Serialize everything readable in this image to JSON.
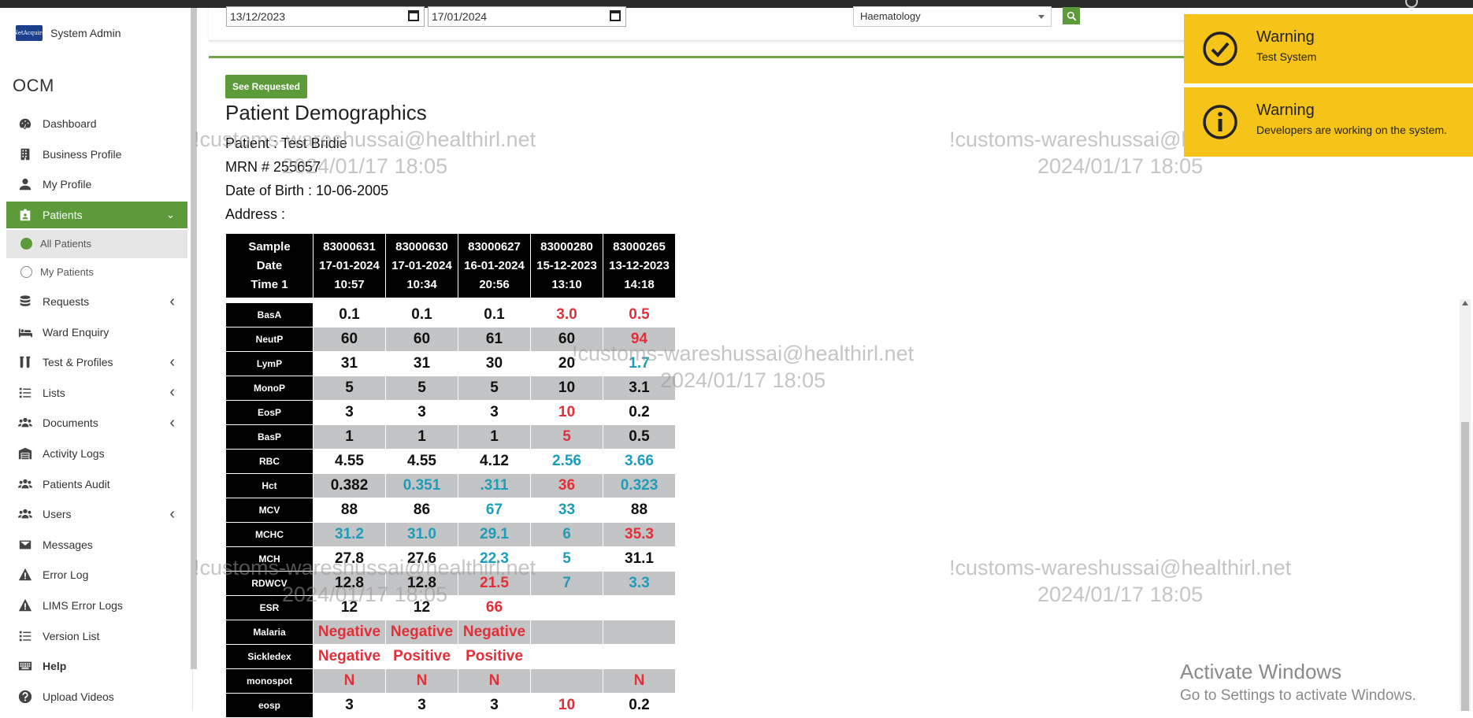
{
  "sidebar": {
    "logo_text": "NetAcquire",
    "user_name": "System Admin",
    "brand": "OCM",
    "items": [
      {
        "label": "Dashboard",
        "icon": "dashboard-icon"
      },
      {
        "label": "Business Profile",
        "icon": "building-icon"
      },
      {
        "label": "My Profile",
        "icon": "user-icon"
      },
      {
        "label": "Patients",
        "icon": "patients-icon",
        "chevron": "down"
      },
      {
        "label": "All Patients",
        "sub": true
      },
      {
        "label": "My Patients",
        "sub": true
      },
      {
        "label": "Requests",
        "icon": "database-icon",
        "chevron": "left"
      },
      {
        "label": "Ward Enquiry",
        "icon": "bed-icon"
      },
      {
        "label": "Test & Profiles",
        "icon": "flask-icon",
        "chevron": "left"
      },
      {
        "label": "Lists",
        "icon": "list-icon",
        "chevron": "left"
      },
      {
        "label": "Documents",
        "icon": "users-icon",
        "chevron": "left"
      },
      {
        "label": "Activity Logs",
        "icon": "warehouse-icon"
      },
      {
        "label": "Patients Audit",
        "icon": "users-icon"
      },
      {
        "label": "Users",
        "icon": "users-icon",
        "chevron": "left"
      },
      {
        "label": "Messages",
        "icon": "envelope-icon"
      },
      {
        "label": "Error Log",
        "icon": "warning-icon"
      },
      {
        "label": "LIMS Error Logs",
        "icon": "warning-icon"
      },
      {
        "label": "Version List",
        "icon": "list-icon"
      },
      {
        "label": "Help",
        "icon": "keyboard-icon"
      },
      {
        "label": "Upload Videos",
        "icon": "question-icon"
      }
    ]
  },
  "filters": {
    "date_from": "13/12/2023",
    "date_to": "17/01/2024",
    "department": "Haematology"
  },
  "actions": {
    "see_requested": "See Requested"
  },
  "patient": {
    "section_title": "Patient Demographics",
    "name_line": "Patient : Test Bridie",
    "mrn_line": "MRN # 255657",
    "dob_line": "Date of Birth : 10-06-2005",
    "address_line": "Address :"
  },
  "results_table": {
    "header_first": [
      "Sample",
      "Date",
      "Time 1"
    ],
    "columns": [
      [
        "83000631",
        "17-01-2024",
        "10:57"
      ],
      [
        "83000630",
        "17-01-2024",
        "10:34"
      ],
      [
        "83000627",
        "16-01-2024",
        "20:56"
      ],
      [
        "83000280",
        "15-12-2023",
        "13:10"
      ],
      [
        "83000265",
        "13-12-2023",
        "14:18"
      ]
    ],
    "rows": [
      {
        "label": "BasA",
        "values": [
          "0.1",
          "0.1",
          "0.1",
          "3.0",
          "0.5"
        ],
        "flags": [
          "",
          "",
          "",
          "high",
          "high"
        ]
      },
      {
        "label": "NeutP",
        "values": [
          "60",
          "60",
          "61",
          "60",
          "94"
        ],
        "flags": [
          "",
          "",
          "",
          "",
          "high"
        ]
      },
      {
        "label": "LymP",
        "values": [
          "31",
          "31",
          "30",
          "20",
          "1.7"
        ],
        "flags": [
          "",
          "",
          "",
          "",
          "low"
        ]
      },
      {
        "label": "MonoP",
        "values": [
          "5",
          "5",
          "5",
          "10",
          "3.1"
        ],
        "flags": [
          "",
          "",
          "",
          "",
          ""
        ]
      },
      {
        "label": "EosP",
        "values": [
          "3",
          "3",
          "3",
          "10",
          "0.2"
        ],
        "flags": [
          "",
          "",
          "",
          "high",
          ""
        ]
      },
      {
        "label": "BasP",
        "values": [
          "1",
          "1",
          "1",
          "5",
          "0.5"
        ],
        "flags": [
          "",
          "",
          "",
          "high",
          ""
        ]
      },
      {
        "label": "RBC",
        "values": [
          "4.55",
          "4.55",
          "4.12",
          "2.56",
          "3.66"
        ],
        "flags": [
          "",
          "",
          "",
          "low",
          "low"
        ]
      },
      {
        "label": "Hct",
        "values": [
          "0.382",
          "0.351",
          ".311",
          "36",
          "0.323"
        ],
        "flags": [
          "",
          "low",
          "low",
          "high",
          "low"
        ]
      },
      {
        "label": "MCV",
        "values": [
          "88",
          "86",
          "67",
          "33",
          "88"
        ],
        "flags": [
          "",
          "",
          "low",
          "low",
          ""
        ]
      },
      {
        "label": "MCHC",
        "values": [
          "31.2",
          "31.0",
          "29.1",
          "6",
          "35.3"
        ],
        "flags": [
          "low",
          "low",
          "low",
          "low",
          "high"
        ]
      },
      {
        "label": "MCH",
        "values": [
          "27.8",
          "27.6",
          "22.3",
          "5",
          "31.1"
        ],
        "flags": [
          "",
          "",
          "low",
          "low",
          ""
        ]
      },
      {
        "label": "RDWCV",
        "values": [
          "12.8",
          "12.8",
          "21.5",
          "7",
          "3.3"
        ],
        "flags": [
          "",
          "",
          "high",
          "low",
          "low"
        ]
      },
      {
        "label": "ESR",
        "values": [
          "12",
          "12",
          "66",
          "",
          ""
        ],
        "flags": [
          "",
          "",
          "high",
          "",
          ""
        ]
      },
      {
        "label": "Malaria",
        "values": [
          "Negative",
          "Negative",
          "Negative",
          "",
          ""
        ],
        "flags": [
          "high",
          "high",
          "high",
          "",
          ""
        ]
      },
      {
        "label": "Sickledex",
        "values": [
          "Negative",
          "Positive",
          "Positive",
          "",
          ""
        ],
        "flags": [
          "high",
          "high",
          "high",
          "",
          ""
        ]
      },
      {
        "label": "monospot",
        "values": [
          "N",
          "N",
          "N",
          "",
          "N"
        ],
        "flags": [
          "high",
          "high",
          "high",
          "",
          "high"
        ]
      },
      {
        "label": "eosp",
        "values": [
          "3",
          "3",
          "3",
          "10",
          "0.2"
        ],
        "flags": [
          "",
          "",
          "",
          "high",
          ""
        ]
      }
    ]
  },
  "watermark": {
    "line1": "!customs-wareshussai@healthirl.net",
    "line2": "2024/01/17 18:05"
  },
  "toasts": [
    {
      "title": "Warning",
      "message": "Test System",
      "icon": "check-circle-icon"
    },
    {
      "title": "Warning",
      "message": "Developers are working on the system.",
      "icon": "info-circle-icon"
    }
  ],
  "os_notice": {
    "line1": "Activate Windows",
    "line2": "Go to Settings to activate Windows."
  },
  "colors": {
    "accent": "#5c9a3a",
    "toast": "#f6c319",
    "high": "#e0303a",
    "low": "#1f9cb8"
  }
}
